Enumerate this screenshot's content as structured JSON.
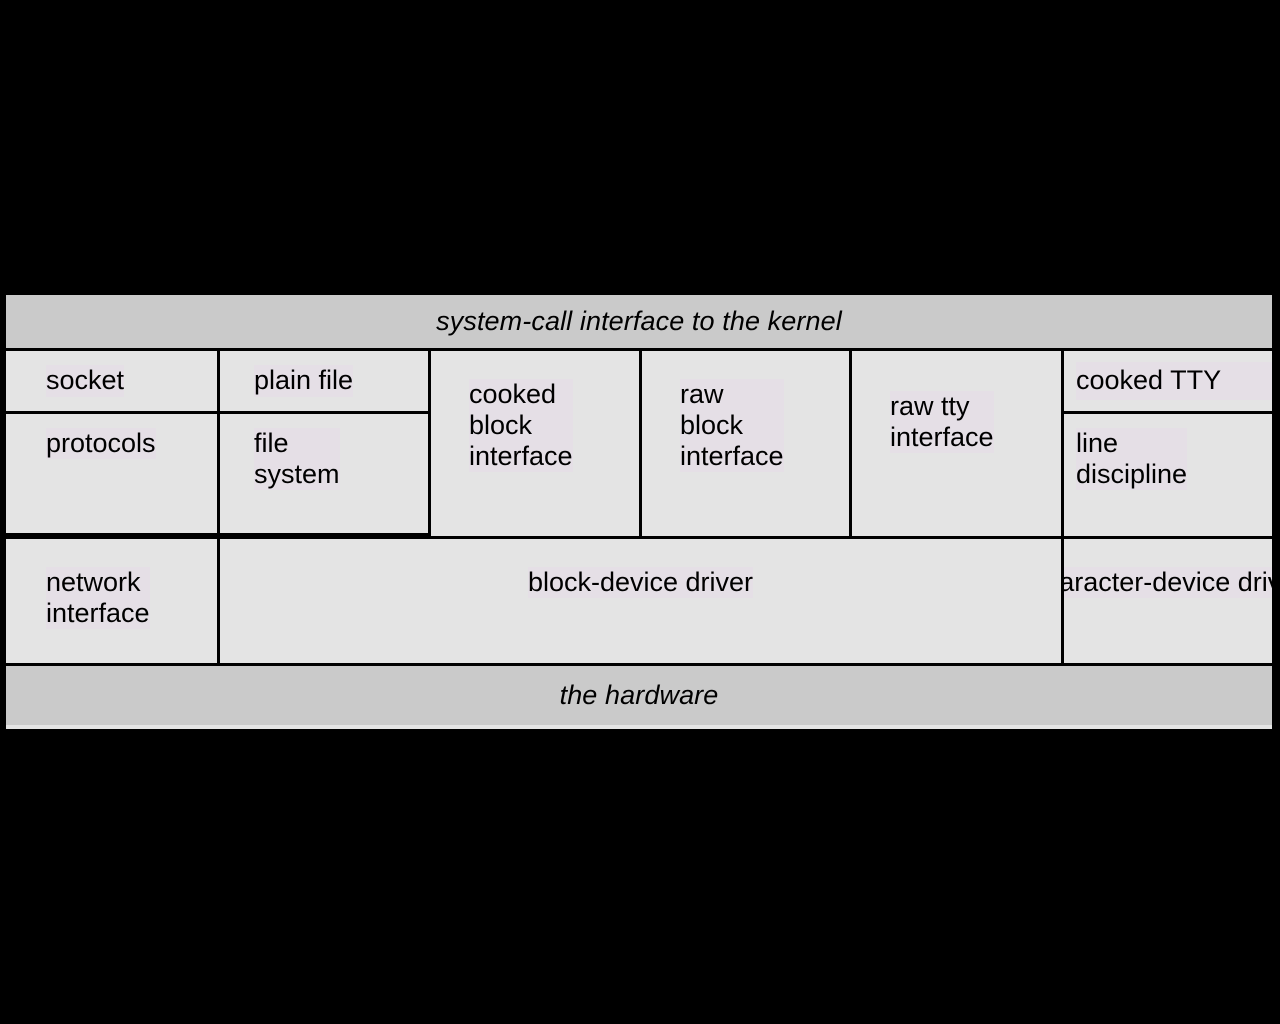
{
  "diagram": {
    "title_banner": "system-call interface to the kernel",
    "bottom_banner": "the hardware",
    "colors": {
      "page_background": "#000000",
      "banner_fill": "#cacaca",
      "cell_fill": "#e4e4e4",
      "text_highlight": "#e5dfe6",
      "rule": "#000000",
      "text": "#000000"
    },
    "rows": [
      {
        "row": "interface-row-1",
        "cells": [
          {
            "label": "socket"
          },
          {
            "label": "plain file"
          },
          {
            "label": "cooked\nblock\ninterface"
          },
          {
            "label": "raw\nblock\ninterface"
          },
          {
            "label": "raw tty\ninterface"
          },
          {
            "label": "cooked TTY"
          }
        ]
      },
      {
        "row": "interface-row-2",
        "cells": [
          {
            "label": "protocols"
          },
          {
            "label": "file\nsystem"
          },
          {
            "label": "line\ndiscipline"
          }
        ]
      },
      {
        "row": "driver-row",
        "cells": [
          {
            "label": "network\ninterface"
          },
          {
            "label": "block-device driver"
          },
          {
            "label": "character-device driver"
          }
        ]
      }
    ]
  }
}
